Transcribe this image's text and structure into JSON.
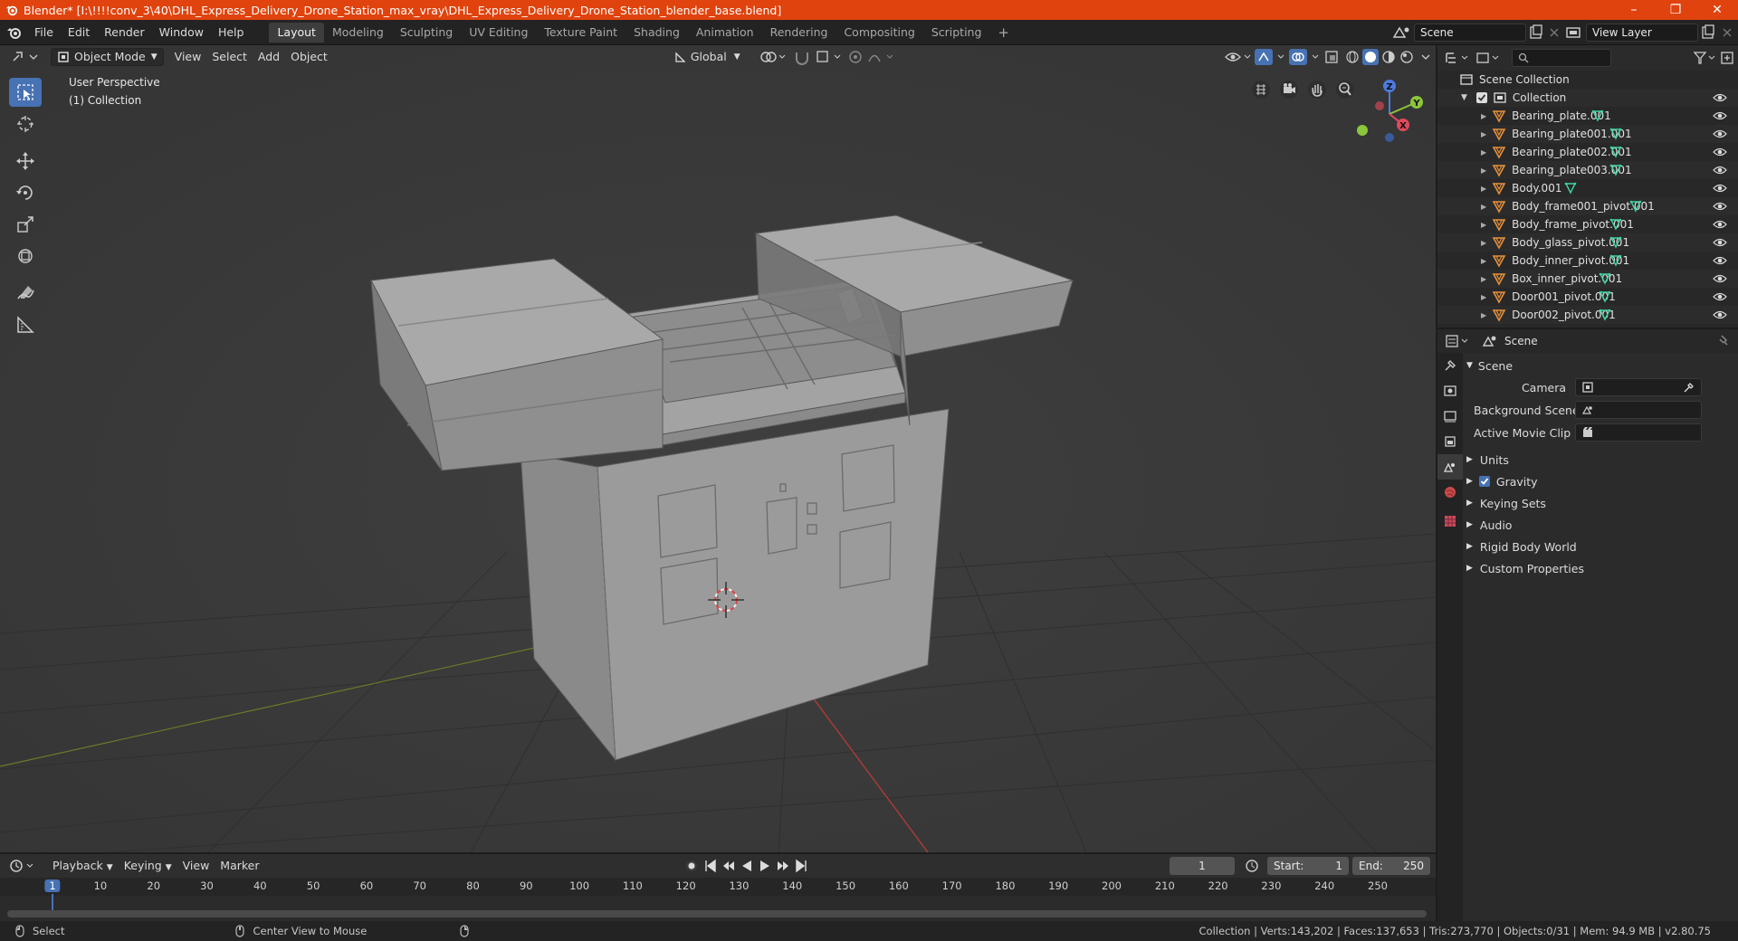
{
  "window": {
    "title": "Blender* [I:\\!!!!conv_3\\40\\DHL_Express_Delivery_Drone_Station_max_vray\\DHL_Express_Delivery_Drone_Station_blender_base.blend]",
    "minimize": "–",
    "maximize": "❐",
    "close": "✕"
  },
  "menu": [
    "File",
    "Edit",
    "Render",
    "Window",
    "Help"
  ],
  "workspaces": [
    "Layout",
    "Modeling",
    "Sculpting",
    "UV Editing",
    "Texture Paint",
    "Shading",
    "Animation",
    "Rendering",
    "Compositing",
    "Scripting"
  ],
  "workspace_add": "+",
  "scene_field": "Scene",
  "view_layer_field": "View Layer",
  "viewport": {
    "mode": "Object Mode",
    "menus": [
      "View",
      "Select",
      "Add",
      "Object"
    ],
    "transform_orientation": "Global",
    "perspective_label": "User Perspective",
    "collection_label": "(1) Collection",
    "gizmo": {
      "x": "X",
      "y": "Y",
      "z": "Z"
    }
  },
  "outliner": {
    "root": "Scene Collection",
    "collection": "Collection",
    "items": [
      "Bearing_plate.001",
      "Bearing_plate001.001",
      "Bearing_plate002.001",
      "Bearing_plate003.001",
      "Body.001",
      "Body_frame001_pivot.001",
      "Body_frame_pivot.001",
      "Body_glass_pivot.001",
      "Body_inner_pivot.001",
      "Box_inner_pivot.001",
      "Door001_pivot.001",
      "Door002_pivot.001"
    ]
  },
  "properties": {
    "context": "Scene",
    "panel": "Scene",
    "camera_label": "Camera",
    "background_scene_label": "Background Scene",
    "active_clip_label": "Active Movie Clip",
    "sections": [
      "Units",
      "Gravity",
      "Keying Sets",
      "Audio",
      "Rigid Body World",
      "Custom Properties"
    ]
  },
  "timeline": {
    "menus": [
      "Playback",
      "Keying",
      "View",
      "Marker"
    ],
    "current_frame": "1",
    "start_label": "Start:",
    "start": "1",
    "end_label": "End:",
    "end": "250",
    "ruler": [
      "1",
      "10",
      "20",
      "30",
      "40",
      "50",
      "60",
      "70",
      "80",
      "90",
      "100",
      "110",
      "120",
      "130",
      "140",
      "150",
      "160",
      "170",
      "180",
      "190",
      "200",
      "210",
      "220",
      "230",
      "240",
      "250"
    ]
  },
  "status": {
    "left_action": "Select",
    "middle_action": "Center View to Mouse",
    "stats": "Collection | Verts:143,202 | Faces:137,653 | Tris:273,770 | Objects:0/31 | Mem: 94.9 MB | v2.80.75"
  },
  "colors": {
    "title_bar": "#e0430d",
    "accent": "#4772b3",
    "mesh_icon": "#e8913a",
    "data_icon": "#3fd4a0"
  }
}
